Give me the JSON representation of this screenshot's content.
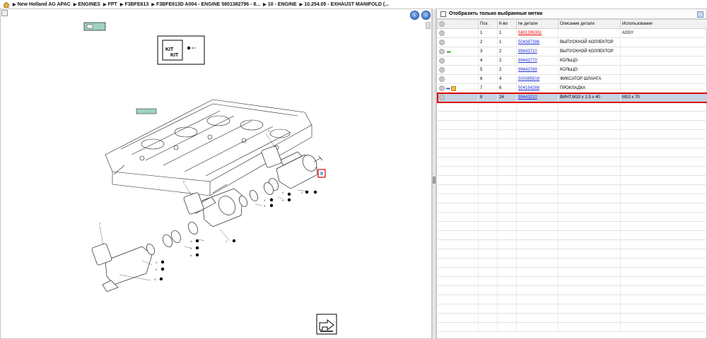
{
  "breadcrumb": [
    "New Holland AG APAC",
    "ENGINES",
    "FPT",
    "F3BFE613",
    "F3BFE613D A004 - ENGINE 5801382796 - 8...",
    "10 - ENGINE",
    "10.254.05 - EXHAUST MANIFOLD (..."
  ],
  "filter": {
    "label": "Отобразить только выбранные метки"
  },
  "table": {
    "headers": [
      "",
      "Поз.",
      "К-во",
      "№ детали",
      "Описание детали",
      "Использование"
    ],
    "rows": [
      {
        "pos": "1",
        "qty": "1",
        "part": "5801395351",
        "desc": "",
        "use": "ASSY",
        "red": true
      },
      {
        "pos": "2",
        "qty": "1",
        "part": "504387396",
        "desc": "ВЫПУСКНОЙ КОЛЛЕКТОР",
        "use": ""
      },
      {
        "pos": "3",
        "qty": "2",
        "part": "99443710",
        "desc": "ВЫПУСКНОЙ КОЛЛЕКТОР",
        "use": ""
      },
      {
        "pos": "4",
        "qty": "2",
        "part": "99443770",
        "desc": "КОЛЬЦО",
        "use": ""
      },
      {
        "pos": "5",
        "qty": "2",
        "part": "99443769",
        "desc": "КОЛЬЦО",
        "use": ""
      },
      {
        "pos": "6",
        "qty": "4",
        "part": "500385816",
        "desc": "ФИКСАТОР ШЛАНГА",
        "use": ""
      },
      {
        "pos": "7",
        "qty": "6",
        "part": "504154288",
        "desc": "ПРОКЛАДКА",
        "use": ""
      },
      {
        "pos": "8",
        "qty": "24",
        "part": "99443210",
        "desc": "ВИНТ,M10 x 1.5 x 40",
        "use": "M10 x 70"
      }
    ]
  },
  "diagram": {
    "kit_legend": "= I",
    "callouts": [
      "1",
      "2",
      "3",
      "4",
      "5",
      "6",
      "7",
      "8"
    ]
  }
}
